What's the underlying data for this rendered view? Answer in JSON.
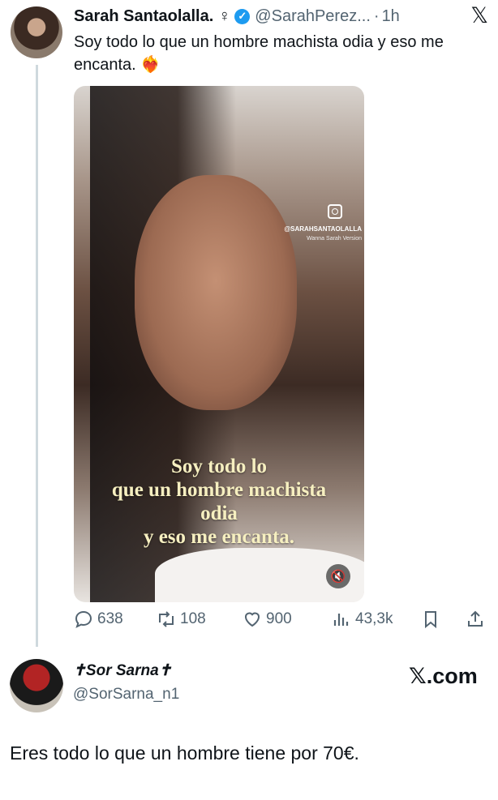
{
  "tweet": {
    "author_name": "Sarah Santaolalla.",
    "gender_symbol": "♀",
    "handle": "@SarahPerez...",
    "separator": "·",
    "time": "1h",
    "text": "Soy todo lo que un hombre machista odia y eso me encanta.",
    "emoji": "❤️‍🔥",
    "media": {
      "watermark_handle": "@SARAHSANTAOLALLA",
      "watermark_sub": "Wanna Sarah Version",
      "caption_lines": [
        "Soy todo lo",
        "que un hombre machista",
        "odia",
        "y eso me encanta."
      ]
    }
  },
  "actions": {
    "replies": "638",
    "retweets": "108",
    "likes": "900",
    "views": "43,3k"
  },
  "reply": {
    "author_name": "✝Sor Sarna✝",
    "handle": "@SorSarna_n1",
    "x_prefix": "𝕏",
    "site": ".com",
    "text": "Eres todo lo que un hombre tiene por 70€."
  },
  "colors": {
    "verified": "#1d9bf0",
    "muted_text": "#536471",
    "thread_line": "#cfd9de",
    "caption": "#f6efc0"
  },
  "icons": [
    "verified-badge-icon",
    "x-logo-icon",
    "reply-icon",
    "retweet-icon",
    "like-icon",
    "views-icon",
    "bookmark-icon",
    "share-icon",
    "mute-icon",
    "instagram-icon"
  ]
}
